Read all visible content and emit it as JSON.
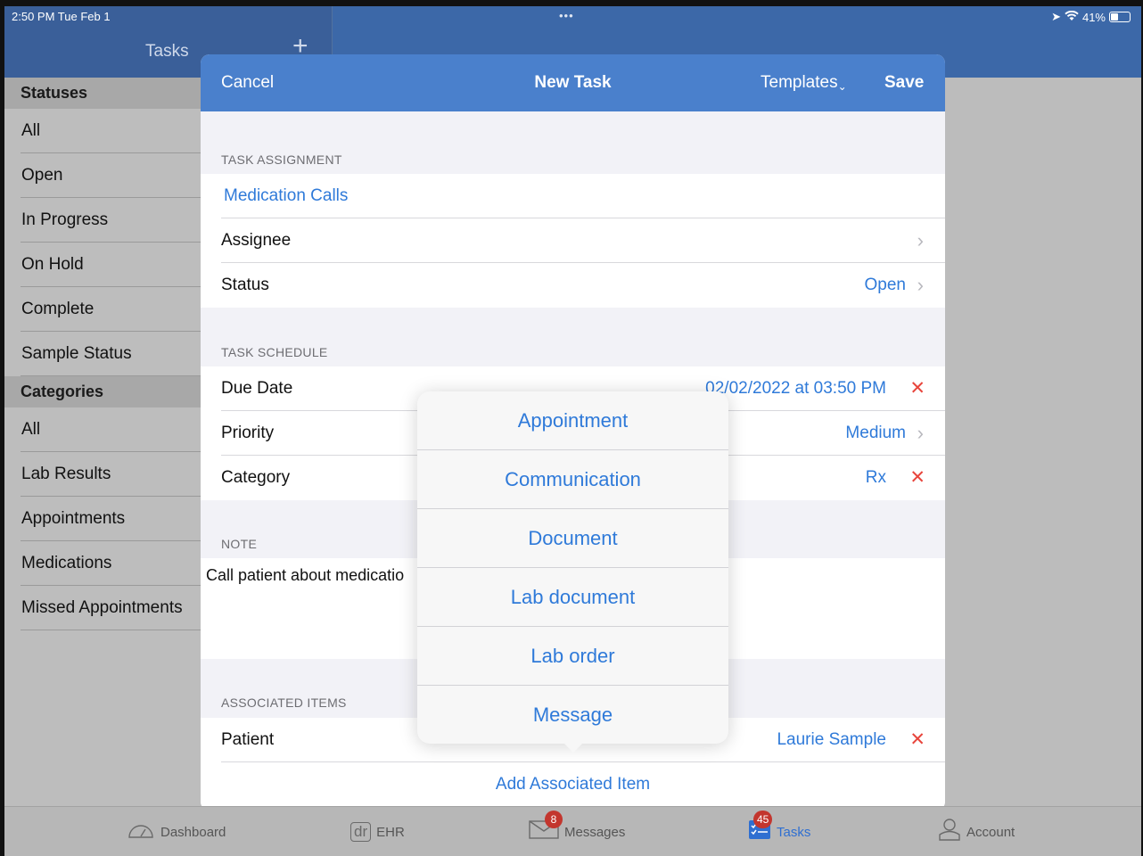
{
  "status_bar": {
    "time": "2:50 PM  Tue Feb 1",
    "dots": "•••",
    "battery": "41%"
  },
  "sidebar": {
    "title": "Tasks",
    "statuses_header": "Statuses",
    "statuses": [
      "All",
      "Open",
      "In Progress",
      "On Hold",
      "Complete",
      "Sample Status"
    ],
    "categories_header": "Categories",
    "categories": [
      "All",
      "Lab Results",
      "Appointments",
      "Medications",
      "Missed Appointments"
    ]
  },
  "modal": {
    "cancel": "Cancel",
    "title": "New Task",
    "templates": "Templates",
    "save": "Save",
    "task_assignment_label": "TASK ASSIGNMENT",
    "task_name": "Medication Calls",
    "assignee_label": "Assignee",
    "status_label": "Status",
    "status_value": "Open",
    "task_schedule_label": "TASK SCHEDULE",
    "due_date_label": "Due Date",
    "due_date_value": "02/02/2022 at 03:50 PM",
    "priority_label": "Priority",
    "priority_value": "Medium",
    "category_label": "Category",
    "category_value": "Rx",
    "note_label": "NOTE",
    "note_text": "Call patient about medicatio",
    "associated_items_label": "ASSOCIATED ITEMS",
    "patient_label": "Patient",
    "patient_value": "Laurie Sample",
    "add_associated_item": "Add Associated Item"
  },
  "popover": {
    "items": [
      "Appointment",
      "Communication",
      "Document",
      "Lab document",
      "Lab order",
      "Message"
    ]
  },
  "tabbar": {
    "dashboard": "Dashboard",
    "ehr": "EHR",
    "ehr_icon_text": "dr",
    "messages": "Messages",
    "messages_badge": "8",
    "tasks": "Tasks",
    "tasks_badge": "45",
    "account": "Account"
  },
  "colors": {
    "accent": "#2f7ad9",
    "nav": "#4a80cc",
    "destructive": "#e8453c",
    "badge": "#c3362e"
  }
}
